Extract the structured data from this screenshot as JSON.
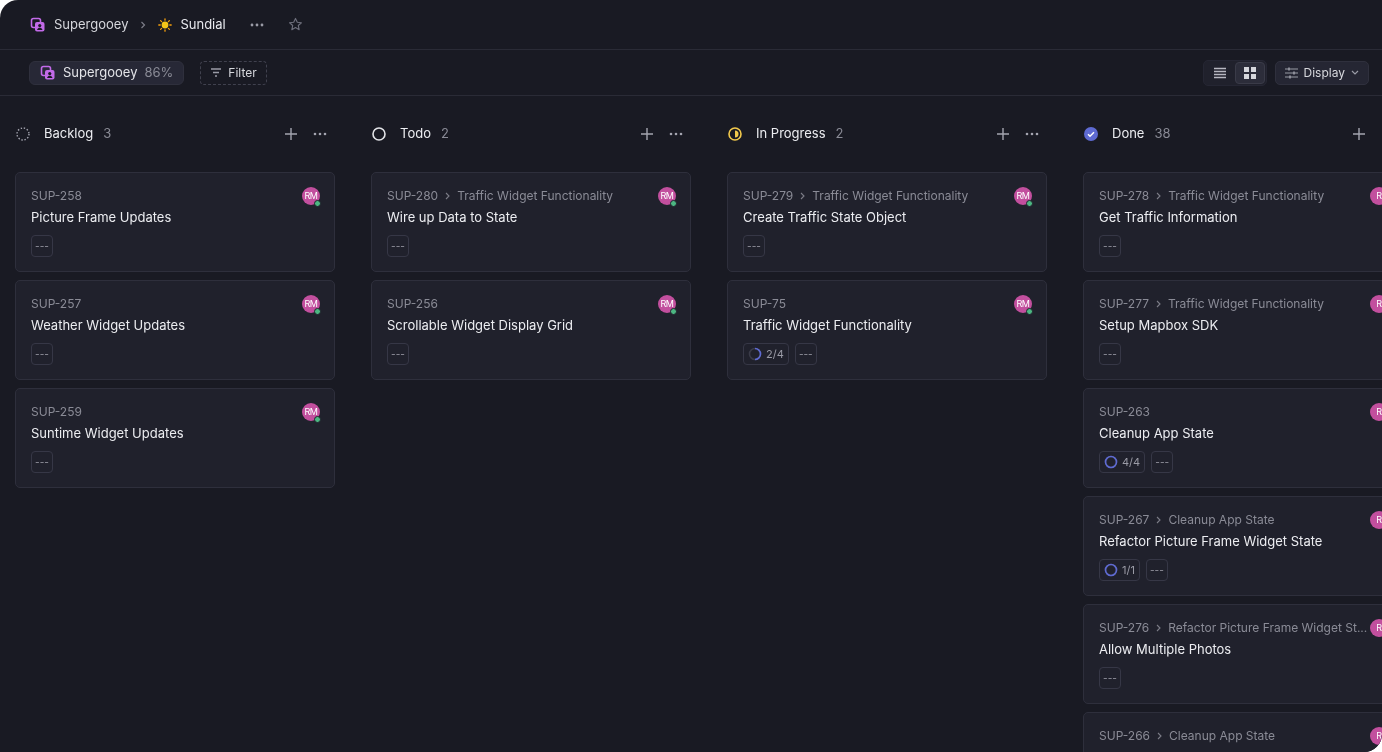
{
  "breadcrumb": {
    "workspace": "Supergooey",
    "project": "Sundial"
  },
  "toolbar": {
    "project_chip": {
      "label": "Supergooey",
      "percent": "86%"
    },
    "filter": "Filter",
    "view_toggle": [
      {
        "kind": "list",
        "selected": false
      },
      {
        "kind": "board",
        "selected": true
      }
    ],
    "display": "Display"
  },
  "columns": [
    {
      "kind": "backlog",
      "title": "Backlog",
      "count": "3",
      "cards": [
        {
          "id": "SUP-258",
          "title": "Picture Frame Updates",
          "assignee": "RM",
          "online": true,
          "tag": "---"
        },
        {
          "id": "SUP-257",
          "title": "Weather Widget Updates",
          "assignee": "RM",
          "online": true,
          "tag": "---"
        },
        {
          "id": "SUP-259",
          "title": "Suntime Widget Updates",
          "assignee": "RM",
          "online": true,
          "tag": "---"
        }
      ]
    },
    {
      "kind": "todo",
      "title": "Todo",
      "count": "2",
      "cards": [
        {
          "id": "SUP-280",
          "parent": "Traffic Widget Functionality",
          "title": "Wire up Data to State",
          "assignee": "RM",
          "online": true,
          "tag": "---"
        },
        {
          "id": "SUP-256",
          "title": "Scrollable Widget Display Grid",
          "assignee": "RM",
          "online": true,
          "tag": "---"
        }
      ]
    },
    {
      "kind": "in_progress",
      "title": "In Progress",
      "count": "2",
      "cards": [
        {
          "id": "SUP-279",
          "parent": "Traffic Widget Functionality",
          "title": "Create Traffic State Object",
          "assignee": "RM",
          "online": true,
          "tag": "---"
        },
        {
          "id": "SUP-75",
          "title": "Traffic Widget Functionality",
          "assignee": "RM",
          "online": true,
          "subtasks": {
            "label": "2/4",
            "complete": false
          },
          "tag": "---"
        }
      ]
    },
    {
      "kind": "done",
      "title": "Done",
      "count": "38",
      "cards": [
        {
          "id": "SUP-278",
          "parent": "Traffic Widget Functionality",
          "title": "Get Traffic Information",
          "assignee": "R",
          "tag": "---"
        },
        {
          "id": "SUP-277",
          "parent": "Traffic Widget Functionality",
          "title": "Setup Mapbox SDK",
          "assignee": "R",
          "tag": "---"
        },
        {
          "id": "SUP-263",
          "title": "Cleanup App State",
          "assignee": "R",
          "subtasks": {
            "label": "4/4",
            "complete": true
          },
          "tag": "---"
        },
        {
          "id": "SUP-267",
          "parent": "Cleanup App State",
          "title": "Refactor Picture Frame Widget State",
          "assignee": "R",
          "subtasks": {
            "label": "1/1",
            "complete": true
          },
          "tag": "---"
        },
        {
          "id": "SUP-276",
          "parent": "Refactor Picture Frame Widget St...",
          "title": "Allow Multiple Photos",
          "assignee": "R",
          "tag": "---"
        },
        {
          "id": "SUP-266",
          "parent": "Cleanup App State",
          "assignee": "R"
        }
      ]
    }
  ]
}
